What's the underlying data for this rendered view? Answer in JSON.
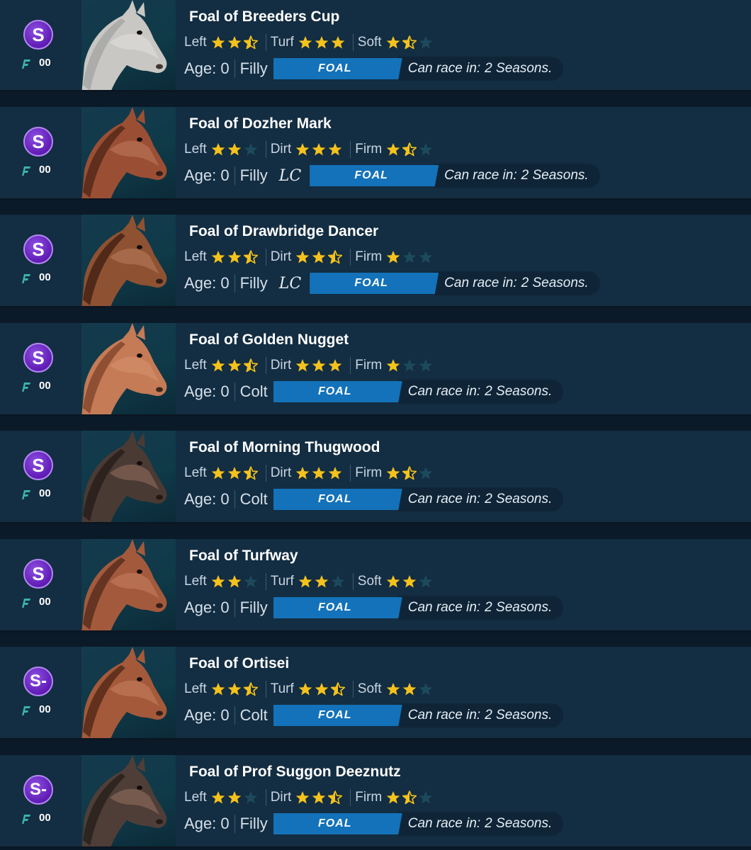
{
  "colors": {
    "star_full": "#f5c21b",
    "star_empty": "#1c4a5c",
    "status_bg": "#1372b9",
    "grade_bg": "#7a35d0"
  },
  "horses": [
    {
      "grade": "S",
      "count": "00",
      "name": "Foal of Breeders Cup",
      "traits": [
        {
          "label": "Left",
          "stars": 2.5
        },
        {
          "label": "Turf",
          "stars": 3
        },
        {
          "label": "Soft",
          "stars": 1.5
        }
      ],
      "age": "Age: 0",
      "sex": "Filly",
      "mark": "",
      "status": "FOAL",
      "race_label": "Can race in:",
      "race_value": "2 Seasons.",
      "coat": "#c9c7c3",
      "mane": "#a8a8a8"
    },
    {
      "grade": "S",
      "count": "00",
      "name": "Foal of Dozher Mark",
      "traits": [
        {
          "label": "Left",
          "stars": 2
        },
        {
          "label": "Dirt",
          "stars": 3
        },
        {
          "label": "Firm",
          "stars": 1.5
        }
      ],
      "age": "Age: 0",
      "sex": "Filly",
      "mark": "LC",
      "status": "FOAL",
      "race_label": "Can race in:",
      "race_value": "2 Seasons.",
      "coat": "#9a4f34",
      "mane": "#5a2a1a"
    },
    {
      "grade": "S",
      "count": "00",
      "name": "Foal of Drawbridge Dancer",
      "traits": [
        {
          "label": "Left",
          "stars": 2.5
        },
        {
          "label": "Dirt",
          "stars": 2.5
        },
        {
          "label": "Firm",
          "stars": 1
        }
      ],
      "age": "Age: 0",
      "sex": "Filly",
      "mark": "LC",
      "status": "FOAL",
      "race_label": "Can race in:",
      "race_value": "2 Seasons.",
      "coat": "#8e5232",
      "mane": "#4a2516"
    },
    {
      "grade": "S",
      "count": "00",
      "name": "Foal of Golden Nugget",
      "traits": [
        {
          "label": "Left",
          "stars": 2.5
        },
        {
          "label": "Dirt",
          "stars": 3
        },
        {
          "label": "Firm",
          "stars": 1
        }
      ],
      "age": "Age: 0",
      "sex": "Colt",
      "mark": "",
      "status": "FOAL",
      "race_label": "Can race in:",
      "race_value": "2 Seasons.",
      "coat": "#c47b56",
      "mane": "#8a4a30"
    },
    {
      "grade": "S",
      "count": "00",
      "name": "Foal of Morning Thugwood",
      "traits": [
        {
          "label": "Left",
          "stars": 2.5
        },
        {
          "label": "Dirt",
          "stars": 3
        },
        {
          "label": "Firm",
          "stars": 1.5
        }
      ],
      "age": "Age: 0",
      "sex": "Colt",
      "mark": "",
      "status": "FOAL",
      "race_label": "Can race in:",
      "race_value": "2 Seasons.",
      "coat": "#4a3a34",
      "mane": "#2a201c"
    },
    {
      "grade": "S",
      "count": "00",
      "name": "Foal of Turfway",
      "traits": [
        {
          "label": "Left",
          "stars": 2
        },
        {
          "label": "Turf",
          "stars": 2
        },
        {
          "label": "Soft",
          "stars": 2
        }
      ],
      "age": "Age: 0",
      "sex": "Filly",
      "mark": "",
      "status": "FOAL",
      "race_label": "Can race in:",
      "race_value": "2 Seasons.",
      "coat": "#a35a3c",
      "mane": "#5e3020"
    },
    {
      "grade": "S-",
      "count": "00",
      "name": "Foal of Ortisei",
      "traits": [
        {
          "label": "Left",
          "stars": 2.5
        },
        {
          "label": "Turf",
          "stars": 2.5
        },
        {
          "label": "Soft",
          "stars": 2
        }
      ],
      "age": "Age: 0",
      "sex": "Colt",
      "mark": "",
      "status": "FOAL",
      "race_label": "Can race in:",
      "race_value": "2 Seasons.",
      "coat": "#a45a3a",
      "mane": "#5a2c1c"
    },
    {
      "grade": "S-",
      "count": "00",
      "name": "Foal of Prof Suggon Deeznutz",
      "traits": [
        {
          "label": "Left",
          "stars": 2
        },
        {
          "label": "Dirt",
          "stars": 2.5
        },
        {
          "label": "Firm",
          "stars": 1.5
        }
      ],
      "age": "Age: 0",
      "sex": "Filly",
      "mark": "",
      "status": "FOAL",
      "race_label": "Can race in:",
      "race_value": "2 Seasons.",
      "coat": "#4f3e38",
      "mane": "#2b221e"
    }
  ]
}
